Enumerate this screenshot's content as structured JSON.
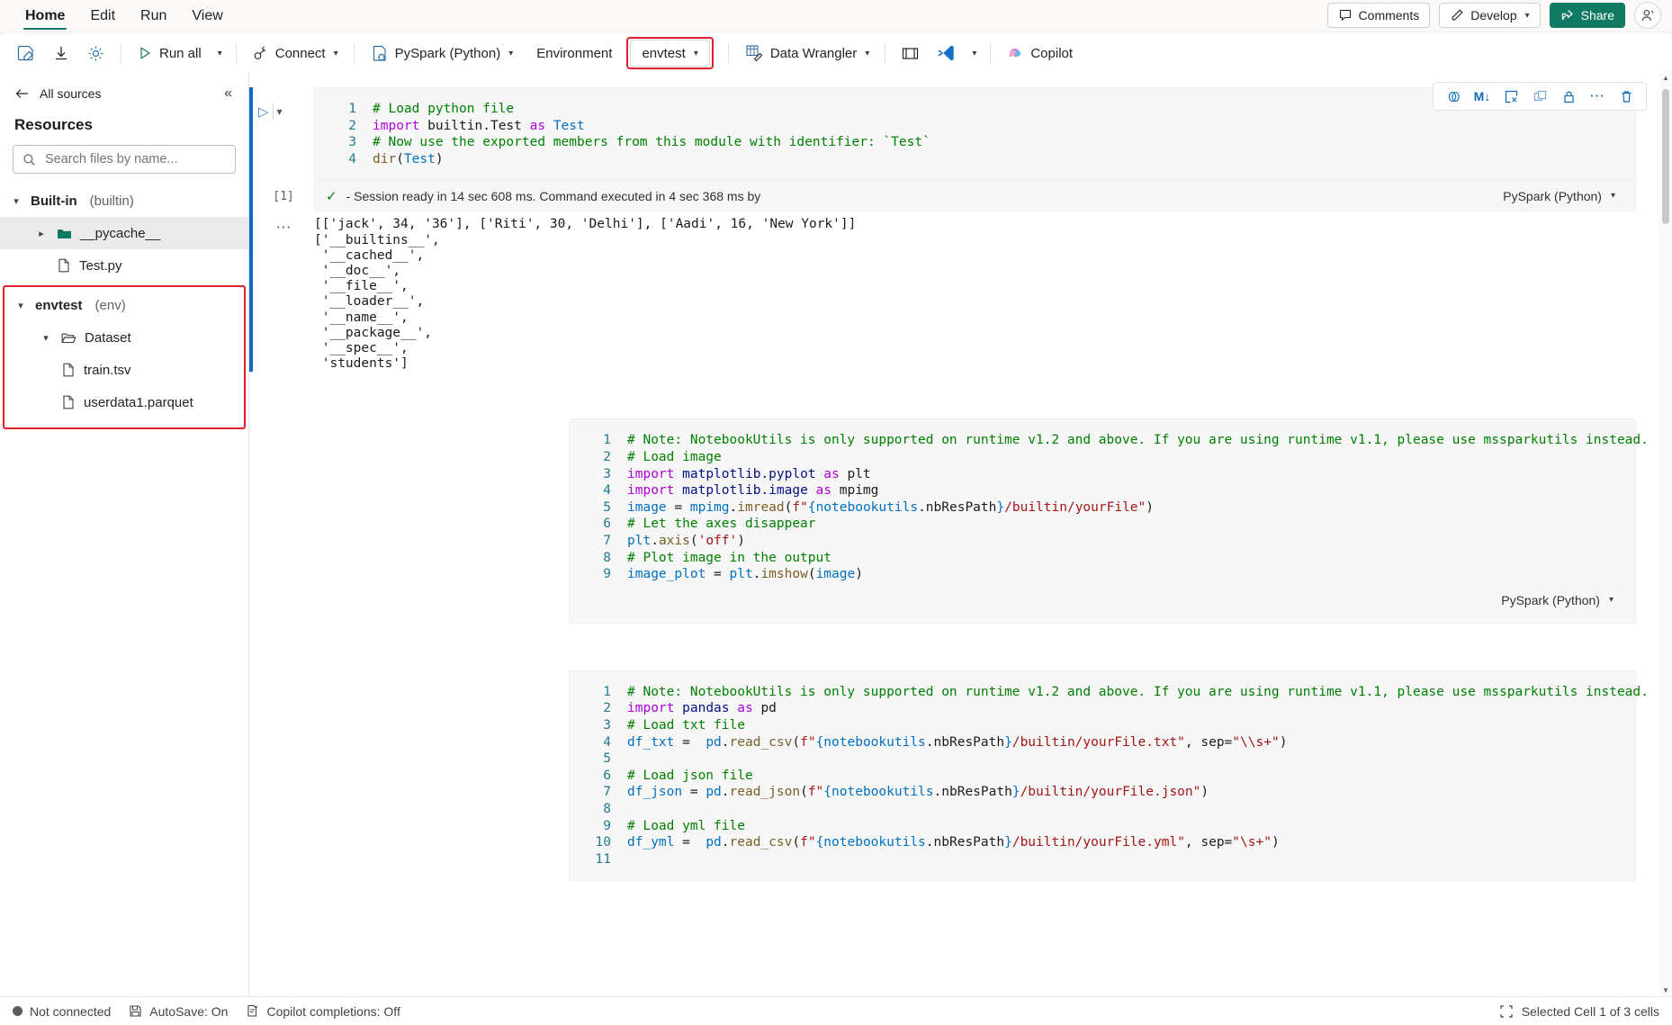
{
  "ribbon": {
    "tabs": [
      {
        "label": "Home",
        "active": true
      },
      {
        "label": "Edit",
        "active": false
      },
      {
        "label": "Run",
        "active": false
      },
      {
        "label": "View",
        "active": false
      }
    ],
    "comments_label": "Comments",
    "develop_label": "Develop",
    "share_label": "Share"
  },
  "toolbar": {
    "run_all_label": "Run all",
    "connect_label": "Connect",
    "kernel_label": "PySpark (Python)",
    "environment_label": "Environment",
    "env_selected_label": "envtest",
    "data_wrangler_label": "Data Wrangler",
    "copilot_label": "Copilot"
  },
  "sidebar": {
    "back_label": "All sources",
    "title": "Resources",
    "search_placeholder": "Search files by name...",
    "groups": [
      {
        "name": "Built-in",
        "suffix": "(builtin)",
        "expanded": true,
        "highlighted": false,
        "items": [
          {
            "label": "__pycache__",
            "type": "folder-closed",
            "indent": 1,
            "caret": "right",
            "selected": true
          },
          {
            "label": "Test.py",
            "type": "file",
            "indent": 2,
            "caret": "none",
            "selected": false
          }
        ]
      },
      {
        "name": "envtest",
        "suffix": "(env)",
        "expanded": true,
        "highlighted": true,
        "items": [
          {
            "label": "Dataset",
            "type": "folder-open",
            "indent": 1,
            "caret": "down",
            "selected": false
          },
          {
            "label": "train.tsv",
            "type": "file",
            "indent": 2,
            "caret": "none",
            "selected": false
          },
          {
            "label": "userdata1.parquet",
            "type": "file",
            "indent": 2,
            "caret": "none",
            "selected": false
          }
        ]
      }
    ]
  },
  "cell_toolbar": {
    "icons": [
      "merge-cells-icon",
      "convert-to-markdown-icon",
      "clear-output-icon",
      "duplicate-cell-icon",
      "lock-cell-icon",
      "more-options-icon",
      "delete-cell-icon"
    ]
  },
  "cells": [
    {
      "id": "cell-1",
      "selected": true,
      "language": "PySpark (Python)",
      "exec_index": "[1]",
      "exec_status": "- Session ready in 14 sec 608 ms. Command executed in 4 sec 368 ms by",
      "lines": [
        {
          "n": "1",
          "tokens": [
            {
              "t": "# Load python file",
              "c": "cm"
            }
          ]
        },
        {
          "n": "2",
          "tokens": [
            {
              "t": "import",
              "c": "kw"
            },
            {
              "t": " builtin.Test ",
              "c": ""
            },
            {
              "t": "as",
              "c": "kw"
            },
            {
              "t": " ",
              "c": ""
            },
            {
              "t": "Test",
              "c": "id"
            }
          ]
        },
        {
          "n": "3",
          "tokens": [
            {
              "t": "# Now use the exported members from this module with identifier: `Test`",
              "c": "cm"
            }
          ]
        },
        {
          "n": "4",
          "tokens": [
            {
              "t": "dir",
              "c": "fn"
            },
            {
              "t": "(",
              "c": ""
            },
            {
              "t": "Test",
              "c": "id"
            },
            {
              "t": ")",
              "c": ""
            }
          ]
        }
      ],
      "output": "[['jack', 34, '36'], ['Riti', 30, 'Delhi'], ['Aadi', 16, 'New York']]\n['__builtins__',\n '__cached__',\n '__doc__',\n '__file__',\n '__loader__',\n '__name__',\n '__package__',\n '__spec__',\n 'students']"
    },
    {
      "id": "cell-2",
      "selected": false,
      "language": "PySpark (Python)",
      "lines": [
        {
          "n": "1",
          "tokens": [
            {
              "t": "# Note: NotebookUtils is only supported on runtime v1.2 and above. If you are using runtime v1.1, please use mssparkutils instead.",
              "c": "cm"
            }
          ]
        },
        {
          "n": "2",
          "tokens": [
            {
              "t": "# Load image",
              "c": "cm"
            }
          ]
        },
        {
          "n": "3",
          "tokens": [
            {
              "t": "import",
              "c": "kw"
            },
            {
              "t": " ",
              "c": ""
            },
            {
              "t": "matplotlib.pyplot",
              "c": "nmspc"
            },
            {
              "t": " ",
              "c": ""
            },
            {
              "t": "as",
              "c": "kw"
            },
            {
              "t": " plt",
              "c": ""
            }
          ]
        },
        {
          "n": "4",
          "tokens": [
            {
              "t": "import",
              "c": "kw"
            },
            {
              "t": " ",
              "c": ""
            },
            {
              "t": "matplotlib.image",
              "c": "nmspc"
            },
            {
              "t": " ",
              "c": ""
            },
            {
              "t": "as",
              "c": "kw"
            },
            {
              "t": " mpimg",
              "c": ""
            }
          ]
        },
        {
          "n": "5",
          "tokens": [
            {
              "t": "image ",
              "c": "id"
            },
            {
              "t": "= ",
              "c": ""
            },
            {
              "t": "mpimg",
              "c": "id"
            },
            {
              "t": ".",
              "c": ""
            },
            {
              "t": "imread",
              "c": "fn"
            },
            {
              "t": "(",
              "c": "brace"
            },
            {
              "t": "f\"",
              "c": "st"
            },
            {
              "t": "{",
              "c": "brace"
            },
            {
              "t": "notebookutils",
              "c": "id"
            },
            {
              "t": ".nbResPath",
              "c": ""
            },
            {
              "t": "}",
              "c": "brace"
            },
            {
              "t": "/builtin/yourFile\"",
              "c": "st"
            },
            {
              "t": ")",
              "c": "brace"
            }
          ]
        },
        {
          "n": "6",
          "tokens": [
            {
              "t": "# Let the axes disappear",
              "c": "cm"
            }
          ]
        },
        {
          "n": "7",
          "tokens": [
            {
              "t": "plt",
              "c": "id"
            },
            {
              "t": ".",
              "c": ""
            },
            {
              "t": "axis",
              "c": "fn"
            },
            {
              "t": "(",
              "c": "brace"
            },
            {
              "t": "'off'",
              "c": "st"
            },
            {
              "t": ")",
              "c": "brace"
            }
          ]
        },
        {
          "n": "8",
          "tokens": [
            {
              "t": "# Plot image in the output",
              "c": "cm"
            }
          ]
        },
        {
          "n": "9",
          "tokens": [
            {
              "t": "image_plot ",
              "c": "id"
            },
            {
              "t": "= ",
              "c": ""
            },
            {
              "t": "plt",
              "c": "id"
            },
            {
              "t": ".",
              "c": ""
            },
            {
              "t": "imshow",
              "c": "fn"
            },
            {
              "t": "(",
              "c": "brace"
            },
            {
              "t": "image",
              "c": "id"
            },
            {
              "t": ")",
              "c": "brace"
            }
          ]
        }
      ]
    },
    {
      "id": "cell-3",
      "selected": false,
      "language": "PySpark (Python)",
      "lines": [
        {
          "n": "1",
          "tokens": [
            {
              "t": "# Note: NotebookUtils is only supported on runtime v1.2 and above. If you are using runtime v1.1, please use mssparkutils instead.",
              "c": "cm"
            }
          ]
        },
        {
          "n": "2",
          "tokens": [
            {
              "t": "import",
              "c": "kw"
            },
            {
              "t": " ",
              "c": ""
            },
            {
              "t": "pandas",
              "c": "nmspc"
            },
            {
              "t": " ",
              "c": ""
            },
            {
              "t": "as",
              "c": "kw"
            },
            {
              "t": " pd",
              "c": ""
            }
          ]
        },
        {
          "n": "3",
          "tokens": [
            {
              "t": "# Load txt file",
              "c": "cm"
            }
          ]
        },
        {
          "n": "4",
          "tokens": [
            {
              "t": "df_txt ",
              "c": "id"
            },
            {
              "t": "=  ",
              "c": ""
            },
            {
              "t": "pd",
              "c": "id"
            },
            {
              "t": ".",
              "c": ""
            },
            {
              "t": "read_csv",
              "c": "fn"
            },
            {
              "t": "(",
              "c": "brace"
            },
            {
              "t": "f\"",
              "c": "st"
            },
            {
              "t": "{",
              "c": "brace"
            },
            {
              "t": "notebookutils",
              "c": "id"
            },
            {
              "t": ".nbResPath",
              "c": ""
            },
            {
              "t": "}",
              "c": "brace"
            },
            {
              "t": "/builtin/yourFile.txt\"",
              "c": "st"
            },
            {
              "t": ", sep=",
              "c": ""
            },
            {
              "t": "\"\\\\s+\"",
              "c": "st"
            },
            {
              "t": ")",
              "c": "brace"
            }
          ]
        },
        {
          "n": "5",
          "tokens": [
            {
              "t": "",
              "c": ""
            }
          ]
        },
        {
          "n": "6",
          "tokens": [
            {
              "t": "# Load json file",
              "c": "cm"
            }
          ]
        },
        {
          "n": "7",
          "tokens": [
            {
              "t": "df_json ",
              "c": "id"
            },
            {
              "t": "= ",
              "c": ""
            },
            {
              "t": "pd",
              "c": "id"
            },
            {
              "t": ".",
              "c": ""
            },
            {
              "t": "read_json",
              "c": "fn"
            },
            {
              "t": "(",
              "c": "brace"
            },
            {
              "t": "f\"",
              "c": "st"
            },
            {
              "t": "{",
              "c": "brace"
            },
            {
              "t": "notebookutils",
              "c": "id"
            },
            {
              "t": ".nbResPath",
              "c": ""
            },
            {
              "t": "}",
              "c": "brace"
            },
            {
              "t": "/builtin/yourFile.json\"",
              "c": "st"
            },
            {
              "t": ")",
              "c": "brace"
            }
          ]
        },
        {
          "n": "8",
          "tokens": [
            {
              "t": "",
              "c": ""
            }
          ]
        },
        {
          "n": "9",
          "tokens": [
            {
              "t": "# Load yml file",
              "c": "cm"
            }
          ]
        },
        {
          "n": "10",
          "tokens": [
            {
              "t": "df_yml ",
              "c": "id"
            },
            {
              "t": "=  ",
              "c": ""
            },
            {
              "t": "pd",
              "c": "id"
            },
            {
              "t": ".",
              "c": ""
            },
            {
              "t": "read_csv",
              "c": "fn"
            },
            {
              "t": "(",
              "c": "brace"
            },
            {
              "t": "f\"",
              "c": "st"
            },
            {
              "t": "{",
              "c": "brace"
            },
            {
              "t": "notebookutils",
              "c": "id"
            },
            {
              "t": ".nbResPath",
              "c": ""
            },
            {
              "t": "}",
              "c": "brace"
            },
            {
              "t": "/builtin/yourFile.yml\"",
              "c": "st"
            },
            {
              "t": ", sep=",
              "c": ""
            },
            {
              "t": "\"\\s+\"",
              "c": "st"
            },
            {
              "t": ")",
              "c": "brace"
            }
          ]
        },
        {
          "n": "11",
          "tokens": [
            {
              "t": "",
              "c": ""
            }
          ]
        }
      ]
    }
  ],
  "statusbar": {
    "connection": "Not connected",
    "autosave": "AutoSave: On",
    "copilot": "Copilot completions: Off",
    "selection": "Selected Cell 1 of 3 cells"
  },
  "colors": {
    "accent": "#107a63",
    "highlight_red": "#e0202a",
    "cell_bar_blue": "#1268c3",
    "icon_blue": "#0f6cbd"
  }
}
